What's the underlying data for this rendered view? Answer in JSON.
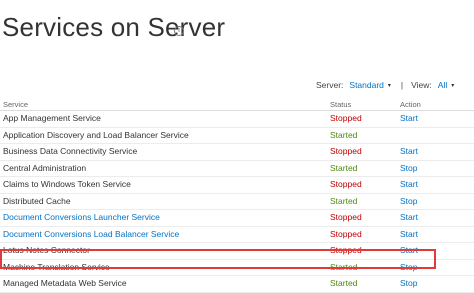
{
  "page": {
    "title": "Services on Server",
    "info_icon": "info-icon"
  },
  "filters": {
    "server_label": "Server:",
    "server_value": "Standard",
    "view_label": "View:",
    "view_value": "All",
    "caret": "▾",
    "separator": "|"
  },
  "table": {
    "columns": [
      "Service",
      "Status",
      "Action"
    ],
    "rows": [
      {
        "service": "App Management Service",
        "status": "Stopped",
        "action": "Start",
        "link": false
      },
      {
        "service": "Application Discovery and Load Balancer Service",
        "status": "Started",
        "action": "",
        "link": false
      },
      {
        "service": "Business Data Connectivity Service",
        "status": "Stopped",
        "action": "Start",
        "link": false
      },
      {
        "service": "Central Administration",
        "status": "Started",
        "action": "Stop",
        "link": false
      },
      {
        "service": "Claims to Windows Token Service",
        "status": "Stopped",
        "action": "Start",
        "link": false
      },
      {
        "service": "Distributed Cache",
        "status": "Started",
        "action": "Stop",
        "link": false
      },
      {
        "service": "Document Conversions Launcher Service",
        "status": "Stopped",
        "action": "Start",
        "link": true
      },
      {
        "service": "Document Conversions Load Balancer Service",
        "status": "Stopped",
        "action": "Start",
        "link": true
      },
      {
        "service": "Lotus Notes Connector",
        "status": "Stopped",
        "action": "Start",
        "link": false
      },
      {
        "service": "Machine Translation Service",
        "status": "Started",
        "action": "Stop",
        "link": false
      },
      {
        "service": "Managed Metadata Web Service",
        "status": "Started",
        "action": "Stop",
        "link": false
      }
    ]
  },
  "colors": {
    "stopped": "#c00000",
    "started": "#4f8a10",
    "link": "#0072c6",
    "highlight": "#e23a3a"
  }
}
